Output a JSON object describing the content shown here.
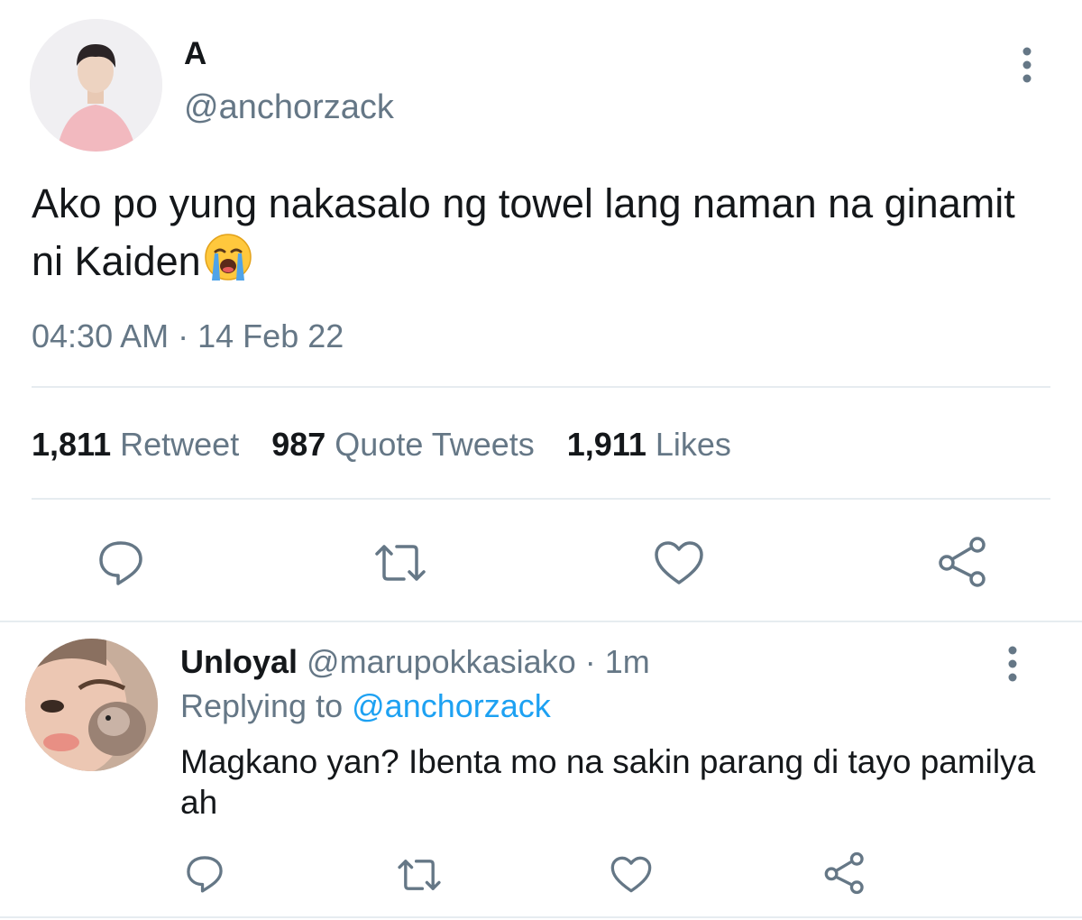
{
  "tweet": {
    "author_name": "A",
    "author_handle": "@anchorzack",
    "text": "Ako po yung nakasalo ng towel lang naman na ginamit ni Kaiden",
    "emoji": "loudly-crying-face",
    "time": "04:30 AM",
    "separator": "·",
    "date": "14 Feb 22",
    "stats": {
      "retweets_count": "1,811",
      "retweets_label": "Retweet",
      "quotes_count": "987",
      "quotes_label": "Quote Tweets",
      "likes_count": "1,911",
      "likes_label": "Likes"
    },
    "actions": [
      "reply-icon",
      "retweet-icon",
      "like-icon",
      "share-icon"
    ]
  },
  "reply": {
    "author_name": "Unloyal",
    "author_handle": "@marupokkasiako",
    "separator": "·",
    "age": "1m",
    "replying_label": "Replying to",
    "replying_handle": "@anchorzack",
    "text": "Magkano yan? Ibenta mo na sakin parang di tayo pamilya ah",
    "actions": [
      "reply-icon",
      "retweet-icon",
      "like-icon",
      "share-icon"
    ]
  },
  "colors": {
    "text": "#14171a",
    "secondary": "#657786",
    "link": "#1da1f2",
    "divider": "#e6ecf0"
  }
}
